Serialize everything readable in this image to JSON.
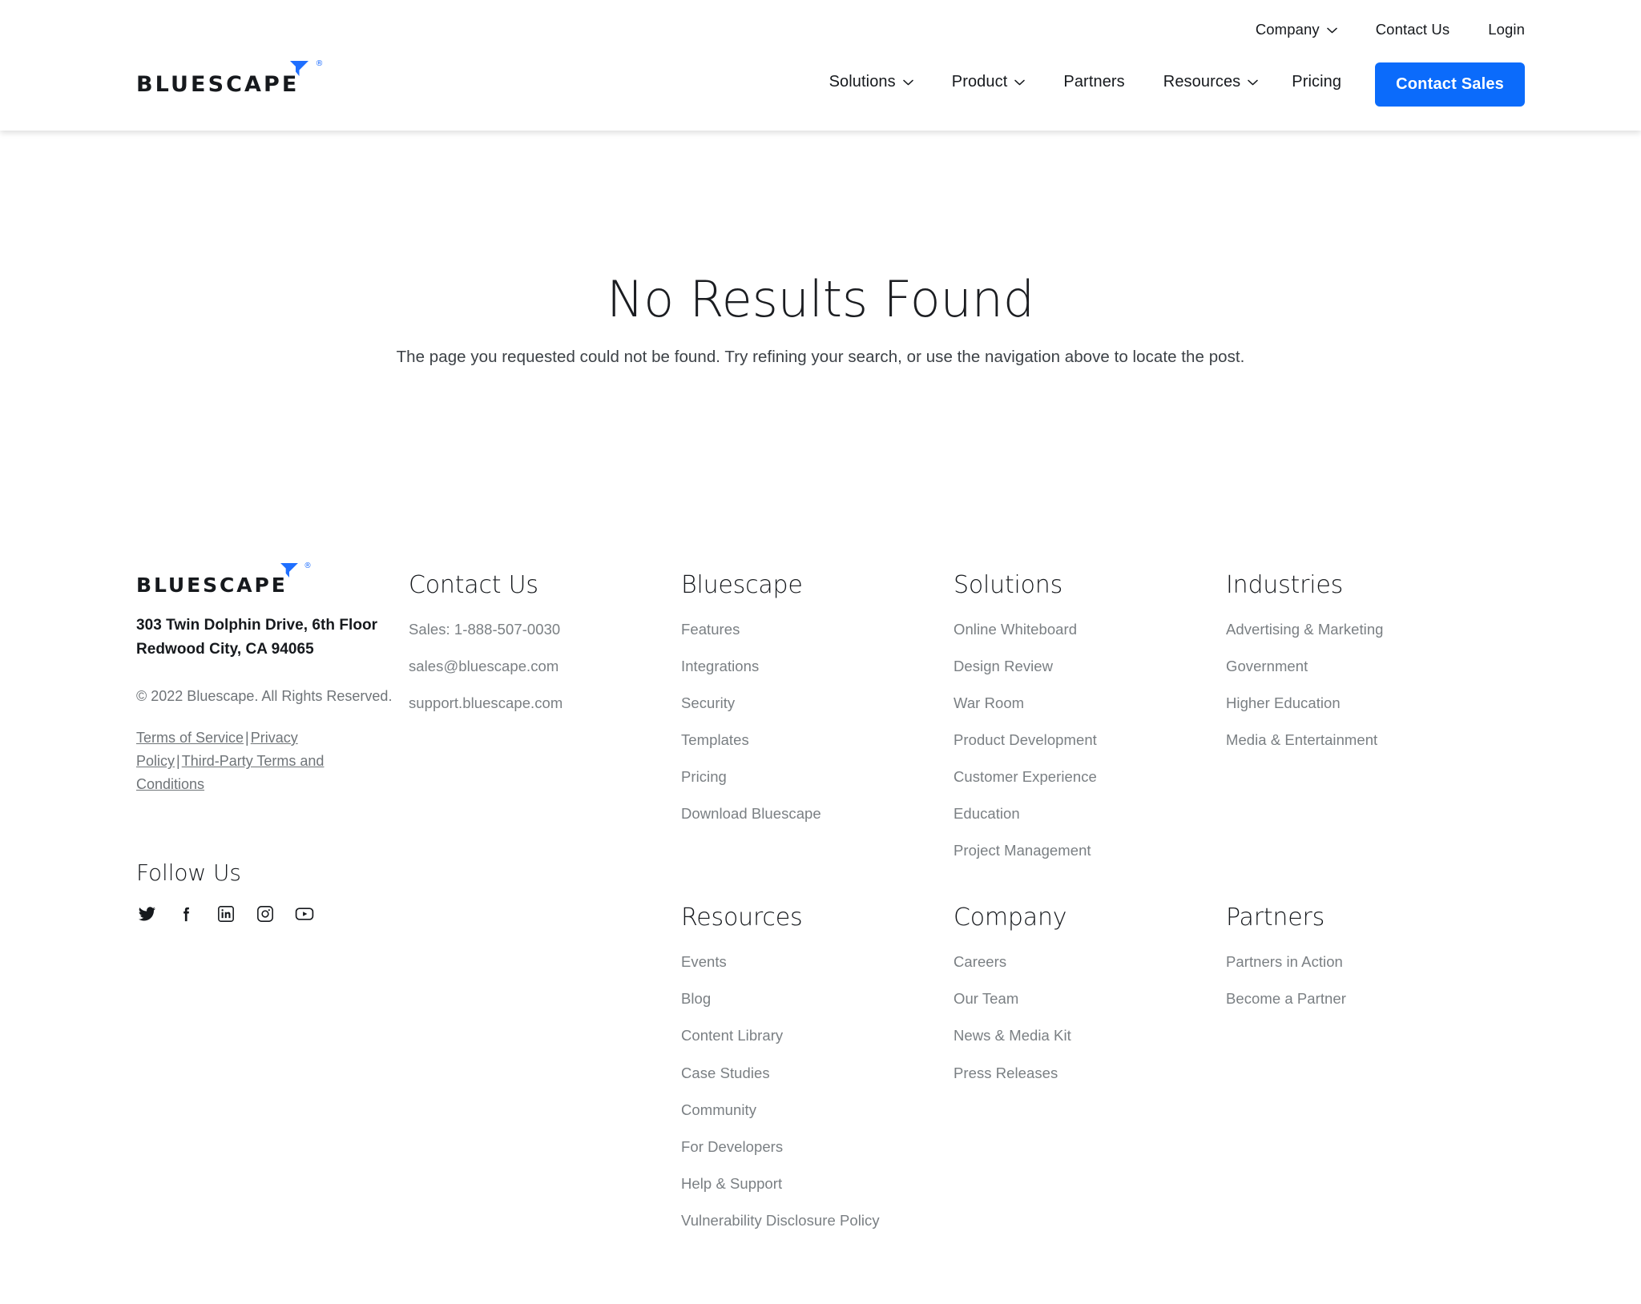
{
  "brand": {
    "name": "BLUESCAPE",
    "registered_mark": "®",
    "accent_color": "#0b6bfb",
    "text_color": "#16191d"
  },
  "header": {
    "utility_nav": [
      {
        "label": "Company",
        "has_dropdown": true,
        "icon": "chevron-down-icon"
      },
      {
        "label": "Contact Us",
        "has_dropdown": false
      },
      {
        "label": "Login",
        "has_dropdown": false
      }
    ],
    "main_nav": [
      {
        "label": "Solutions",
        "has_dropdown": true,
        "icon": "chevron-down-icon"
      },
      {
        "label": "Product",
        "has_dropdown": true,
        "icon": "chevron-down-icon"
      },
      {
        "label": "Partners",
        "has_dropdown": false
      },
      {
        "label": "Resources",
        "has_dropdown": true,
        "icon": "chevron-down-icon"
      },
      {
        "label": "Pricing",
        "has_dropdown": false
      }
    ],
    "cta": {
      "label": "Contact Sales",
      "background": "#0b6bfb",
      "color": "#ffffff"
    }
  },
  "main": {
    "title": "No Results Found",
    "subtitle": "The page you requested could not be found. Try refining your search, or use the navigation above to locate the post."
  },
  "footer": {
    "brand": {
      "address_line1": "303 Twin Dolphin Drive, 6th Floor",
      "address_line2": "Redwood City, CA 94065",
      "copyright": "© 2022 Bluescape. All Rights Reserved.",
      "legal_links": [
        {
          "label": "Terms of Service"
        },
        {
          "label": "Privacy Policy"
        },
        {
          "label": "Third-Party Terms and Conditions"
        }
      ],
      "legal_separator": "|",
      "follow_heading": "Follow Us",
      "social": [
        {
          "name": "twitter-icon",
          "label": "Twitter"
        },
        {
          "name": "facebook-icon",
          "label": "Facebook"
        },
        {
          "name": "linkedin-icon",
          "label": "LinkedIn"
        },
        {
          "name": "instagram-icon",
          "label": "Instagram"
        },
        {
          "name": "youtube-icon",
          "label": "YouTube"
        }
      ]
    },
    "columns": {
      "contact": {
        "title": "Contact Us",
        "items": [
          "Sales: 1-888-507-0030",
          "sales@bluescape.com",
          "support.bluescape.com"
        ]
      },
      "bluescape": {
        "title": "Bluescape",
        "items": [
          "Features",
          "Integrations",
          "Security",
          "Templates",
          "Pricing",
          "Download Bluescape"
        ]
      },
      "solutions": {
        "title": "Solutions",
        "items": [
          "Online Whiteboard",
          "Design Review",
          "War Room",
          "Product Development",
          "Customer Experience",
          "Education",
          "Project Management"
        ]
      },
      "industries": {
        "title": "Industries",
        "items": [
          "Advertising & Marketing",
          "Government",
          "Higher Education",
          "Media & Entertainment"
        ]
      },
      "resources": {
        "title": "Resources",
        "items": [
          "Events",
          "Blog",
          "Content Library",
          "Case Studies",
          "Community",
          "For Developers",
          "Help & Support",
          "Vulnerability Disclosure Policy"
        ]
      },
      "company": {
        "title": "Company",
        "items": [
          "Careers",
          "Our Team",
          "News & Media Kit",
          "Press Releases"
        ]
      },
      "partners": {
        "title": "Partners",
        "items": [
          "Partners in Action",
          "Become a Partner"
        ]
      }
    }
  }
}
